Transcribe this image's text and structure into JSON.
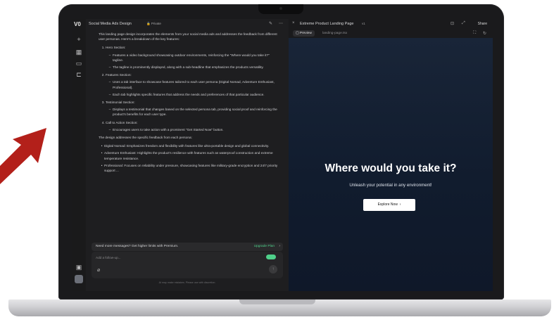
{
  "left_panel": {
    "title": "Social Media Ads Design",
    "private_badge": "Private",
    "intro": "This landing page design incorporates the elements from your social media ads and addresses the feedback from different user personas. Here's a breakdown of the key features:",
    "sections": [
      {
        "heading": "Hero Section:",
        "points": [
          "Features a video background showcasing outdoor environments, reinforcing the \"Where would you take it?\" tagline.",
          "The tagline is prominently displayed, along with a sub-headline that emphasizes the products versatility."
        ]
      },
      {
        "heading": "Features Section:",
        "points": [
          "Uses a tab interface to showcase features tailored to each user persona (Digital Nomad, Adventure Enthusiast, Professional).",
          "Each tab highlights specific features that address the needs and preferences of that particular audience."
        ]
      },
      {
        "heading": "Testimonial Section:",
        "points": [
          "Displays a testimonial that changes based on the selected persona tab, providing social proof and reinforcing the product's benefits for each user type."
        ]
      },
      {
        "heading": "Call to Action Section:",
        "points": [
          "Encourages users to take action with a prominent \"Get Started Now\" button."
        ]
      }
    ],
    "feedback_intro": "The design addresses the specific feedback from each persona:",
    "feedback": [
      "Digital Nomad: Emphasizes freedom and flexibility with features like ultra-portable design and global connectivity.",
      "Adventure Enthusiast: Highlights the product's resilience with features such as waterproof construction and extreme temperature resistance.",
      "Professional: Focuses on reliability under pressure, showcasing features like military-grade encryption and 24/7 priority support ..."
    ],
    "promo_text": "Need more messages? Get higher limits with Premium.",
    "promo_link": "Upgrade Plan",
    "input_placeholder": "Add a follow-up...",
    "disclaimer": "AI may make mistakes. Please use with discretion."
  },
  "right_panel": {
    "title": "Extreme Product Landing Page",
    "version": "v1",
    "share_label": "Share",
    "tab_preview": "Preview",
    "tab_file": "landing-page.tsx",
    "hero_heading": "Where would you take it?",
    "hero_sub": "Unleash your potential in any environment!",
    "hero_button": "Explore Now"
  },
  "colors": {
    "accent_arrow": "#b3201a",
    "upgrade_link": "#4fd08a",
    "landing_bg": "#141f32"
  }
}
